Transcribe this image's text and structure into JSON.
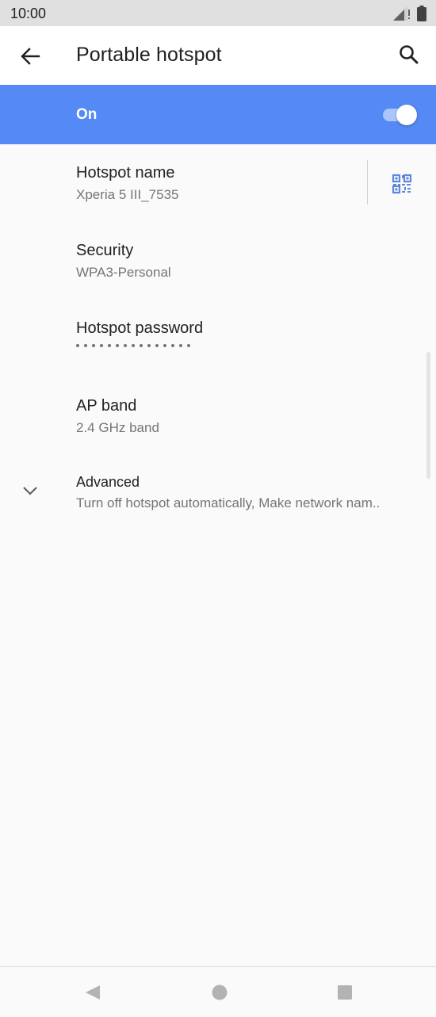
{
  "status_bar": {
    "time": "10:00"
  },
  "app_bar": {
    "title": "Portable hotspot",
    "back_icon": "arrow-back-icon",
    "search_icon": "search-icon"
  },
  "master_switch": {
    "label": "On",
    "checked": true,
    "accent_color": "#5589f5"
  },
  "preferences": [
    {
      "title": "Hotspot name",
      "summary": "Xperia 5 III_7535",
      "action_icon": "qr-code-icon"
    },
    {
      "title": "Security",
      "summary": "WPA3-Personal"
    },
    {
      "title": "Hotspot password",
      "summary_masked": true,
      "mask_dots": 15
    },
    {
      "title": "AP band",
      "summary": "2.4 GHz band"
    },
    {
      "title": "Advanced",
      "summary": "Turn off hotspot automatically, Make network nam..",
      "expand_icon": "chevron-down-icon"
    }
  ],
  "nav_bar": {
    "back_icon": "nav-back-icon",
    "home_icon": "nav-home-icon",
    "recents_icon": "nav-recents-icon"
  }
}
